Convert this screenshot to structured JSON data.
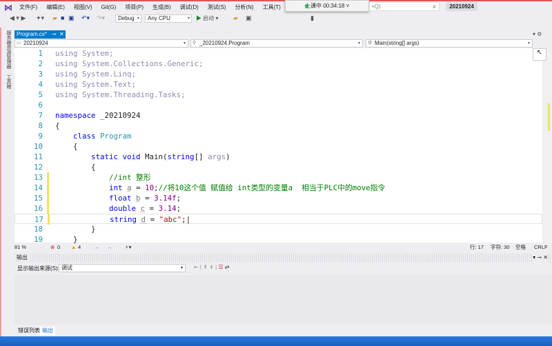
{
  "menubar": {
    "items": [
      "文件(F)",
      "编辑(E)",
      "视图(V)",
      "Git(G)",
      "项目(P)",
      "生成(B)",
      "调试(D)",
      "测试(S)",
      "分析(N)",
      "工具(T)",
      "扩展(X)"
    ]
  },
  "session": {
    "label": "上课中 00:34:18",
    "status_color": "#1fb84a"
  },
  "search": {
    "placeholder": "+Q)"
  },
  "project_name": "20210924",
  "toolbar": {
    "config": "Debug",
    "platform": "Any CPU",
    "start_label": "启动"
  },
  "side_tabs": [
    "服务器资源管理器",
    "工具箱"
  ],
  "document_tab": {
    "label": "Program.cs*"
  },
  "navbar": {
    "project": "20210924",
    "class": "_20210924.Program",
    "member": "Main(string[] args)"
  },
  "code_lines": [
    {
      "n": "1",
      "html": "<span class='dim'>using System;</span>"
    },
    {
      "n": "2",
      "html": "<span class='dim'>using System.Collections.Generic;</span>"
    },
    {
      "n": "3",
      "html": "<span class='dim'>using System.Linq;</span>"
    },
    {
      "n": "4",
      "html": "<span class='dim'>using System.Text;</span>"
    },
    {
      "n": "5",
      "html": "<span class='dim'>using System.Threading.Tasks;</span>"
    },
    {
      "n": "6",
      "html": ""
    },
    {
      "n": "7",
      "html": "<span class='kw'>namespace</span> _20210924"
    },
    {
      "n": "8",
      "html": "{"
    },
    {
      "n": "9",
      "html": "    <span class='kw'>class</span> <span class='ty'>Program</span>"
    },
    {
      "n": "10",
      "html": "    {"
    },
    {
      "n": "11",
      "html": "        <span class='kw'>static void</span> Main(<span class='kw'>string</span>[] <span class='dim'>args</span>)"
    },
    {
      "n": "12",
      "html": "        {"
    },
    {
      "n": "13",
      "html": "            <span class='cm'>//int 整形</span>",
      "chg": true
    },
    {
      "n": "14",
      "html": "            <span class='kw'>int</span> <span class='ul'>a</span> = <span class='nm'>10</span>;<span class='cm'>//将10这个值 赋值给 int类型的变量a  相当于PLC中的move指令</span>",
      "chg": true
    },
    {
      "n": "15",
      "html": "            <span class='kw'>float</span> <span class='ul'>b</span> = <span class='nm'>3.14f</span>;",
      "chg": true
    },
    {
      "n": "16",
      "html": "            <span class='kw'>double</span> <span class='ul'>c</span> = <span class='nm'>3.14</span>;",
      "chg": true
    },
    {
      "n": "17",
      "html": "            <span class='kw'>string</span> <span class='ul'>d</span> = <span class='st'>\"abc\"</span>;|",
      "chg": true,
      "current": true
    },
    {
      "n": "18",
      "html": "        }"
    },
    {
      "n": "19",
      "html": "    }"
    }
  ],
  "status": {
    "zoom": "81 %",
    "errors": "0",
    "warnings": "4",
    "line": "行: 17",
    "char": "字符: 30",
    "spaces": "空格",
    "eol": "CRLF"
  },
  "output": {
    "title": "输出",
    "source_label": "显示输出来源(S):",
    "source_value": "调试"
  },
  "bottom_tabs": [
    "错误列表",
    "输出"
  ],
  "colors": {
    "accent": "#007acc",
    "taskbar": "#1b5fc0"
  }
}
